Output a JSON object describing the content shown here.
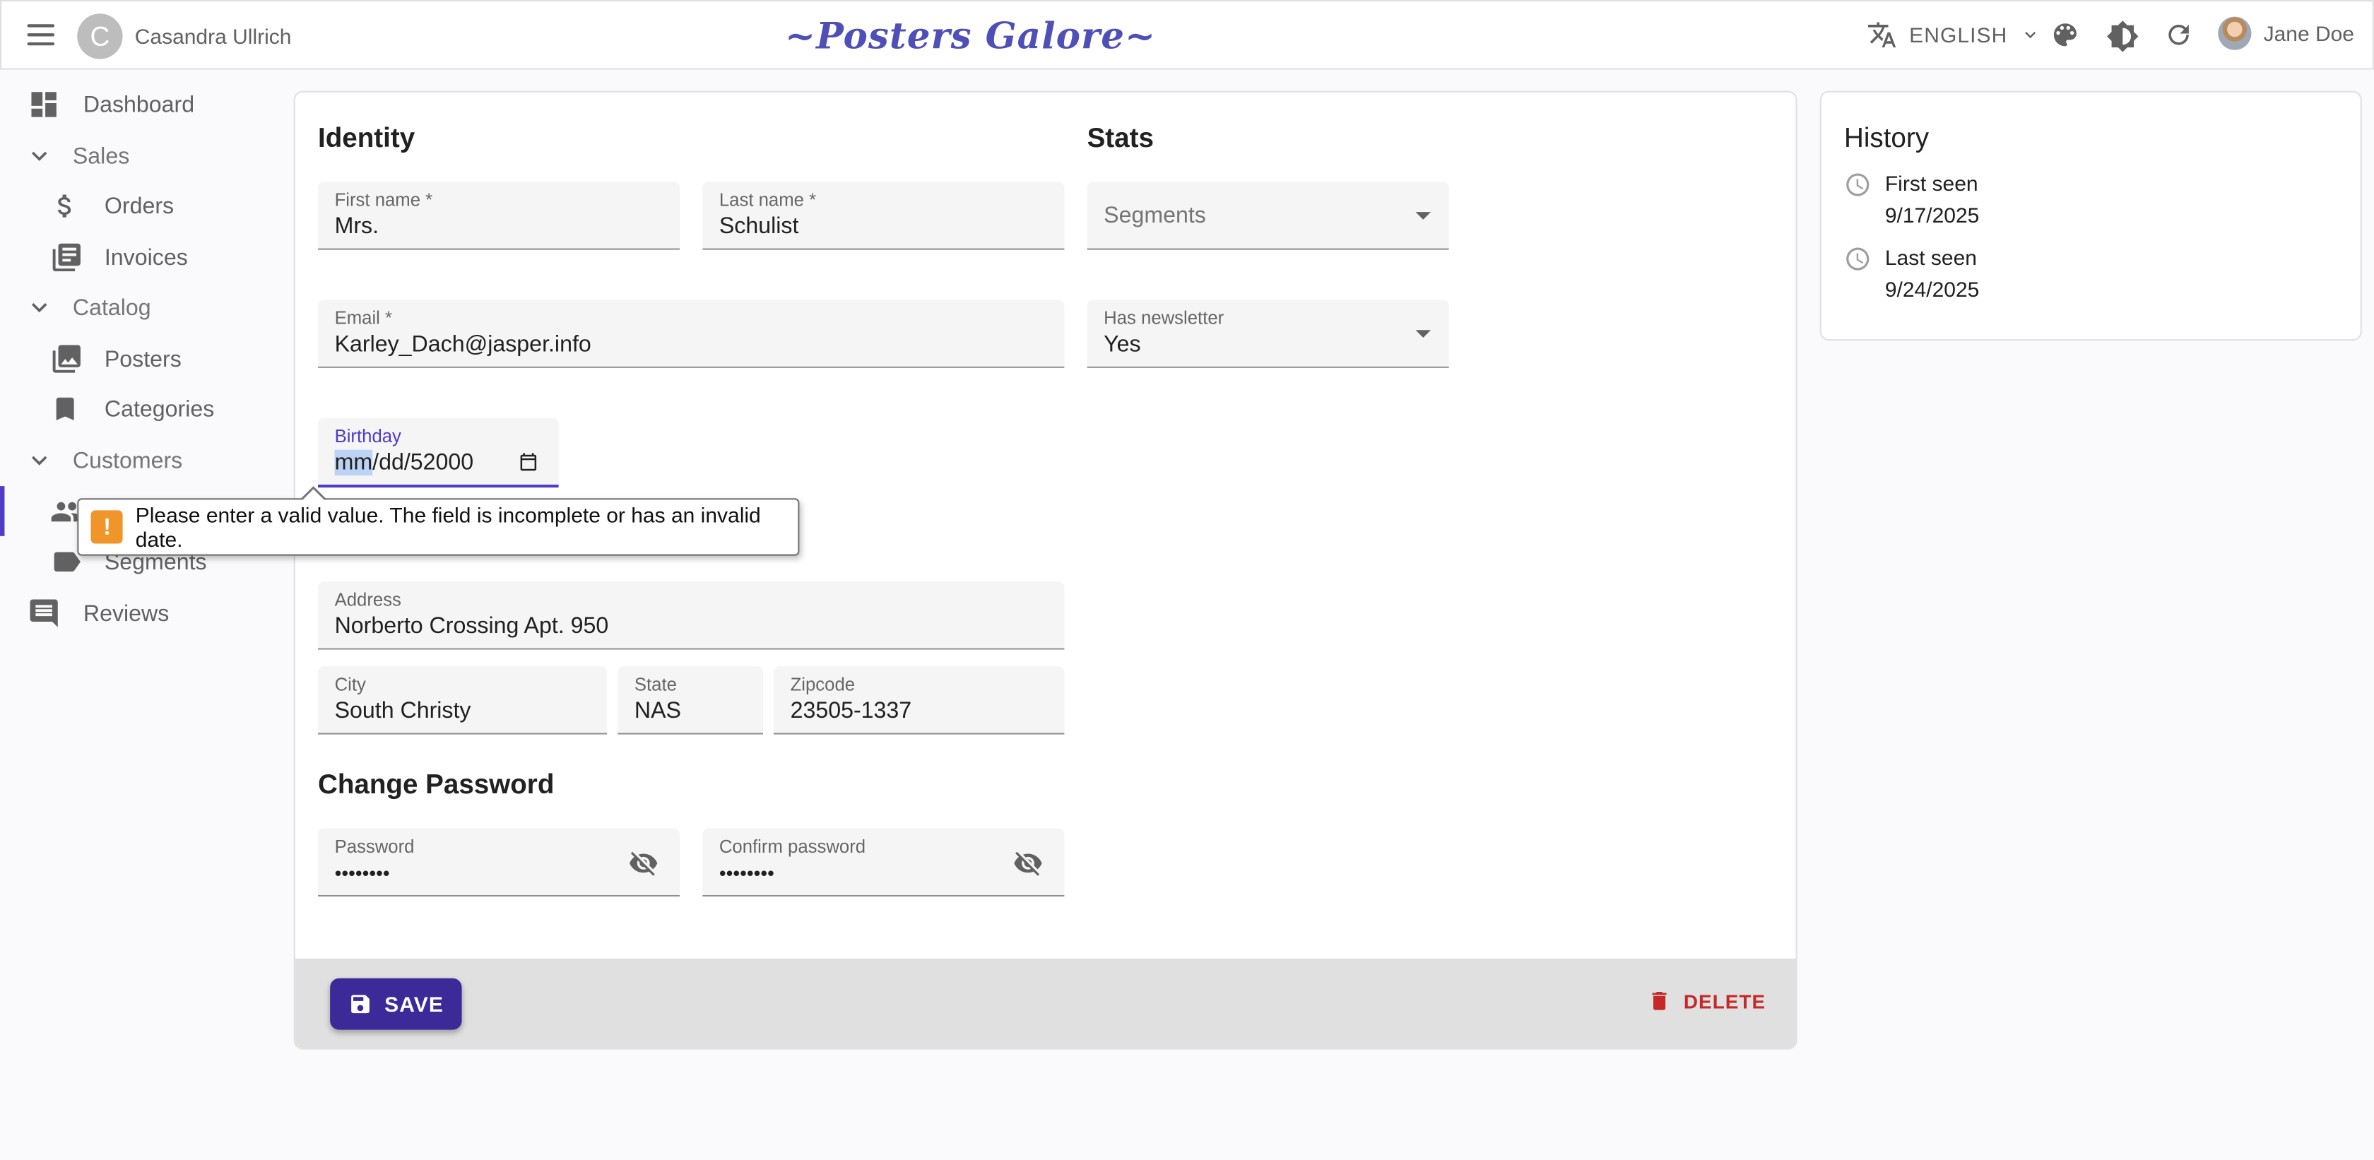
{
  "header": {
    "tenant_initial": "C",
    "tenant_name": "Casandra Ullrich",
    "brand": "~Posters Galore~",
    "language": "ENGLISH",
    "user_name": "Jane Doe"
  },
  "sidebar": {
    "items": [
      {
        "label": "Dashboard",
        "icon": "dashboard-icon"
      },
      {
        "label": "Sales",
        "icon": "chevron-down-icon",
        "group": true
      },
      {
        "label": "Orders",
        "icon": "dollar-icon"
      },
      {
        "label": "Invoices",
        "icon": "invoices-icon"
      },
      {
        "label": "Catalog",
        "icon": "chevron-down-icon",
        "group": true
      },
      {
        "label": "Posters",
        "icon": "image-icon"
      },
      {
        "label": "Categories",
        "icon": "bookmark-icon"
      },
      {
        "label": "Customers",
        "icon": "chevron-down-icon",
        "group": true
      },
      {
        "label": "Segments",
        "icon": "label-icon"
      },
      {
        "label": "Reviews",
        "icon": "comment-icon"
      }
    ]
  },
  "form": {
    "identity_title": "Identity",
    "stats_title": "Stats",
    "first_name_label": "First name *",
    "first_name_value": "Mrs.",
    "last_name_label": "Last name *",
    "last_name_value": "Schulist",
    "email_label": "Email *",
    "email_value": "Karley_Dach@jasper.info",
    "birthday_label": "Birthday",
    "birthday_mm": "mm",
    "birthday_rest": "/dd/52000",
    "segments_placeholder": "Segments",
    "newsletter_label": "Has newsletter",
    "newsletter_value": "Yes",
    "address_label": "Address",
    "address_value": "Norberto Crossing Apt. 950",
    "city_label": "City",
    "city_value": "South Christy",
    "state_label": "State",
    "state_value": "NAS",
    "zipcode_label": "Zipcode",
    "zipcode_value": "23505-1337",
    "change_password_title": "Change Password",
    "password_label": "Password",
    "password_value": "••••••••",
    "confirm_password_label": "Confirm password",
    "confirm_password_value": "••••••••"
  },
  "toolbar": {
    "save_label": "SAVE",
    "delete_label": "DELETE"
  },
  "validation": {
    "message": "Please enter a valid value. The field is incomplete or has an invalid date."
  },
  "history": {
    "title": "History",
    "first_seen_label": "First seen",
    "first_seen_date": "9/17/2025",
    "last_seen_label": "Last seen",
    "last_seen_date": "9/24/2025"
  },
  "colors": {
    "accent": "#4f3cc9",
    "save_button": "#3c2a98",
    "delete": "#c62828",
    "brand": "#4f4fb8",
    "warning": "#f0952a"
  }
}
